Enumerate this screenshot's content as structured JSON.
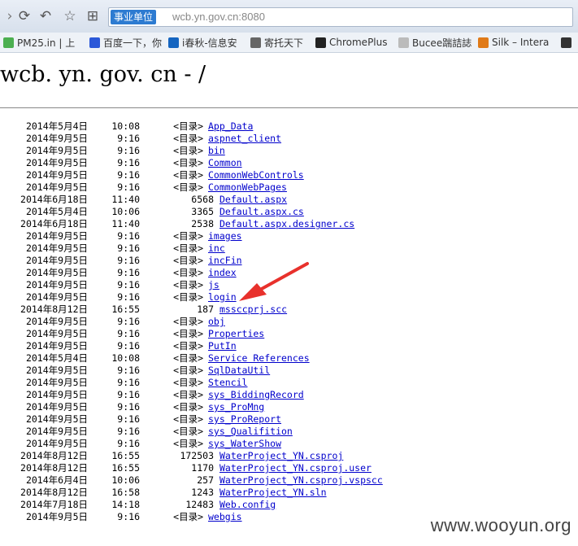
{
  "browser": {
    "address_badge": "事业单位",
    "address_url": "wcb.yn.gov.cn:8080",
    "bookmarks": [
      {
        "label": "PM25.in | 上",
        "icon": "leaf-icon",
        "color": "#4caf50"
      },
      {
        "label": "百度一下，你",
        "icon": "paw-icon",
        "color": "#2b58d8"
      },
      {
        "label": "i春秋-信息安",
        "icon": "info-icon",
        "color": "#1565c0"
      },
      {
        "label": "寄托天下",
        "icon": "bird-icon",
        "color": "#666666"
      },
      {
        "label": "ChromePlus",
        "icon": "github-icon",
        "color": "#222222"
      },
      {
        "label": "Bucee踹詰誌",
        "icon": "page-icon",
        "color": "#bbbbbb"
      },
      {
        "label": "Silk – Intera",
        "icon": "silk-icon",
        "color": "#e07a18"
      }
    ]
  },
  "page": {
    "title": "wcb. yn. gov. cn - /",
    "watermark": "www.wooyun.org",
    "entries": [
      {
        "date": "2014年5月4日",
        "time": "10:08",
        "size": "<目录>",
        "name": "App_Data",
        "dir": true
      },
      {
        "date": "2014年9月5日",
        "time": "9:16",
        "size": "<目录>",
        "name": "aspnet_client",
        "dir": true
      },
      {
        "date": "2014年9月5日",
        "time": "9:16",
        "size": "<目录>",
        "name": "bin",
        "dir": true
      },
      {
        "date": "2014年9月5日",
        "time": "9:16",
        "size": "<目录>",
        "name": "Common",
        "dir": true
      },
      {
        "date": "2014年9月5日",
        "time": "9:16",
        "size": "<目录>",
        "name": "CommonWebControls",
        "dir": true
      },
      {
        "date": "2014年9月5日",
        "time": "9:16",
        "size": "<目录>",
        "name": "CommonWebPages",
        "dir": true
      },
      {
        "date": "2014年6月18日",
        "time": "11:40",
        "size": "6568",
        "name": "Default.aspx",
        "dir": false
      },
      {
        "date": "2014年5月4日",
        "time": "10:06",
        "size": "3365",
        "name": "Default.aspx.cs",
        "dir": false
      },
      {
        "date": "2014年6月18日",
        "time": "11:40",
        "size": "2538",
        "name": "Default.aspx.designer.cs",
        "dir": false
      },
      {
        "date": "2014年9月5日",
        "time": "9:16",
        "size": "<目录>",
        "name": "images",
        "dir": true
      },
      {
        "date": "2014年9月5日",
        "time": "9:16",
        "size": "<目录>",
        "name": "inc",
        "dir": true
      },
      {
        "date": "2014年9月5日",
        "time": "9:16",
        "size": "<目录>",
        "name": "incFin",
        "dir": true
      },
      {
        "date": "2014年9月5日",
        "time": "9:16",
        "size": "<目录>",
        "name": "index",
        "dir": true
      },
      {
        "date": "2014年9月5日",
        "time": "9:16",
        "size": "<目录>",
        "name": "js",
        "dir": true
      },
      {
        "date": "2014年9月5日",
        "time": "9:16",
        "size": "<目录>",
        "name": "login",
        "dir": true
      },
      {
        "date": "2014年8月12日",
        "time": "16:55",
        "size": "187",
        "name": "mssccprj.scc",
        "dir": false
      },
      {
        "date": "2014年9月5日",
        "time": "9:16",
        "size": "<目录>",
        "name": "obj",
        "dir": true
      },
      {
        "date": "2014年9月5日",
        "time": "9:16",
        "size": "<目录>",
        "name": "Properties",
        "dir": true
      },
      {
        "date": "2014年9月5日",
        "time": "9:16",
        "size": "<目录>",
        "name": "PutIn",
        "dir": true
      },
      {
        "date": "2014年5月4日",
        "time": "10:08",
        "size": "<目录>",
        "name": "Service References",
        "dir": true
      },
      {
        "date": "2014年9月5日",
        "time": "9:16",
        "size": "<目录>",
        "name": "SqlDataUtil",
        "dir": true
      },
      {
        "date": "2014年9月5日",
        "time": "9:16",
        "size": "<目录>",
        "name": "Stencil",
        "dir": true
      },
      {
        "date": "2014年9月5日",
        "time": "9:16",
        "size": "<目录>",
        "name": "sys_BiddingRecord",
        "dir": true
      },
      {
        "date": "2014年9月5日",
        "time": "9:16",
        "size": "<目录>",
        "name": "sys_ProMng",
        "dir": true
      },
      {
        "date": "2014年9月5日",
        "time": "9:16",
        "size": "<目录>",
        "name": "sys_ProReport",
        "dir": true
      },
      {
        "date": "2014年9月5日",
        "time": "9:16",
        "size": "<目录>",
        "name": "sys_Qualifition",
        "dir": true
      },
      {
        "date": "2014年9月5日",
        "time": "9:16",
        "size": "<目录>",
        "name": "sys_WaterShow",
        "dir": true
      },
      {
        "date": "2014年8月12日",
        "time": "16:55",
        "size": "172503",
        "name": "WaterProject_YN.csproj",
        "dir": false
      },
      {
        "date": "2014年8月12日",
        "time": "16:55",
        "size": "1170",
        "name": "WaterProject_YN.csproj.user",
        "dir": false
      },
      {
        "date": "2014年6月4日",
        "time": "10:06",
        "size": "257",
        "name": "WaterProject_YN.csproj.vspscc",
        "dir": false
      },
      {
        "date": "2014年8月12日",
        "time": "16:58",
        "size": "1243",
        "name": "WaterProject_YN.sln",
        "dir": false
      },
      {
        "date": "2014年7月18日",
        "time": "14:18",
        "size": "12483",
        "name": "Web.config",
        "dir": false
      },
      {
        "date": "2014年9月5日",
        "time": "9:16",
        "size": "<目录>",
        "name": "webgis",
        "dir": true
      }
    ]
  },
  "colors": {
    "link": "#0000cc",
    "arrow": "#e8312c",
    "toolbar": "#dbe3ef"
  }
}
